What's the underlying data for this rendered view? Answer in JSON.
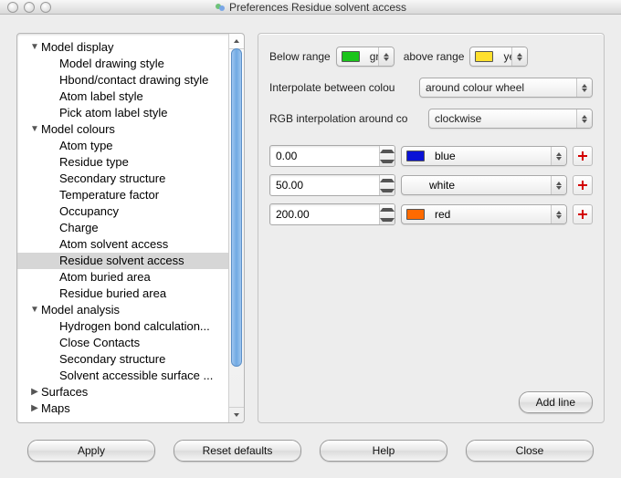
{
  "title": "Preferences  Residue solvent access",
  "tree": [
    {
      "label": "Model display",
      "indent": 0,
      "disclosure": "down"
    },
    {
      "label": "Model drawing style",
      "indent": 1
    },
    {
      "label": "Hbond/contact drawing style",
      "indent": 1
    },
    {
      "label": "Atom label style",
      "indent": 1
    },
    {
      "label": "Pick atom label style",
      "indent": 1
    },
    {
      "label": "Model colours",
      "indent": 0,
      "disclosure": "down"
    },
    {
      "label": "Atom type",
      "indent": 1
    },
    {
      "label": "Residue type",
      "indent": 1
    },
    {
      "label": "Secondary structure",
      "indent": 1
    },
    {
      "label": "Temperature factor",
      "indent": 1
    },
    {
      "label": "Occupancy",
      "indent": 1
    },
    {
      "label": "Charge",
      "indent": 1
    },
    {
      "label": "Atom solvent access",
      "indent": 1
    },
    {
      "label": "Residue solvent access",
      "indent": 1,
      "selected": true
    },
    {
      "label": "Atom buried area",
      "indent": 1
    },
    {
      "label": "Residue buried area",
      "indent": 1
    },
    {
      "label": "Model analysis",
      "indent": 0,
      "disclosure": "down"
    },
    {
      "label": "Hydrogen bond calculation...",
      "indent": 1
    },
    {
      "label": "Close Contacts",
      "indent": 1
    },
    {
      "label": "Secondary structure",
      "indent": 1
    },
    {
      "label": "Solvent accessible surface ...",
      "indent": 1
    },
    {
      "label": "Surfaces",
      "indent": 0,
      "disclosure": "right"
    },
    {
      "label": "Maps",
      "indent": 0,
      "disclosure": "right"
    }
  ],
  "panel": {
    "below_label": "Below range",
    "below_select": {
      "swatch": "#1bc41b",
      "text": "gree"
    },
    "above_label": "above range",
    "above_select": {
      "swatch": "#ffe02e",
      "text": "yello"
    },
    "interp_label": "Interpolate between colou",
    "interp_value": "around colour wheel",
    "rgb_label": "RGB interpolation around co",
    "rgb_value": "clockwise",
    "lines": [
      {
        "value": "0.00",
        "swatch": "#0a12d6",
        "color": "blue"
      },
      {
        "value": "50.00",
        "swatch": "#ffffff",
        "color": "white",
        "noSwatch": true
      },
      {
        "value": "200.00",
        "swatch": "#ff6a00",
        "color": "red"
      }
    ],
    "add_line": "Add line"
  },
  "buttons": {
    "apply": "Apply",
    "reset": "Reset defaults",
    "help": "Help",
    "close": "Close"
  }
}
